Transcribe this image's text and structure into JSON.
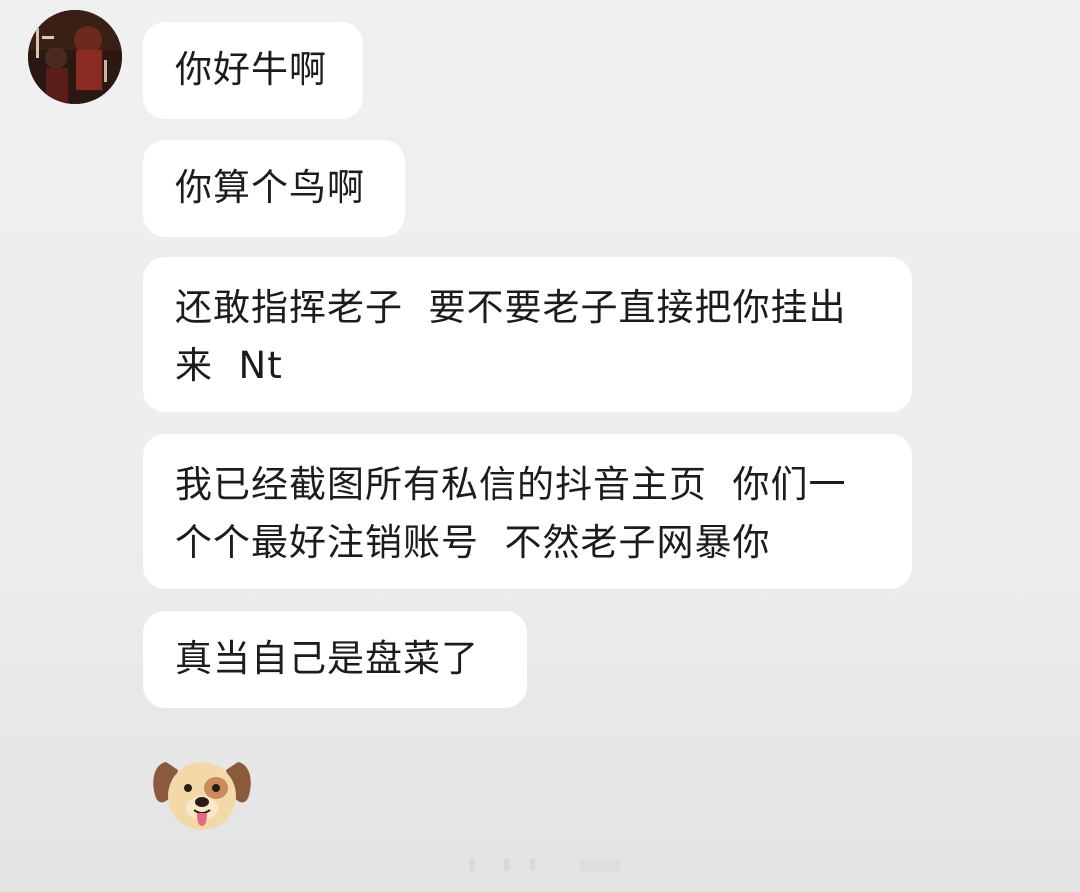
{
  "chat": {
    "avatar": {
      "icon": "profile-avatar-icon"
    },
    "messages": [
      {
        "text": "你好牛啊"
      },
      {
        "text": "你算个鸟啊"
      },
      {
        "text": "还敢指挥老子  要不要老子直接把你挂出\n来  Nt"
      },
      {
        "text": "我已经截图所有私信的抖音主页  你们一\n个个最好注销账号  不然老子网暴你"
      },
      {
        "text": "真当自己是盘菜了"
      }
    ],
    "emoji": {
      "icon": "dog-face-emoji-icon"
    }
  },
  "colors": {
    "background": "#ededed",
    "bubble": "#ffffff",
    "text": "#1c1c1c"
  }
}
